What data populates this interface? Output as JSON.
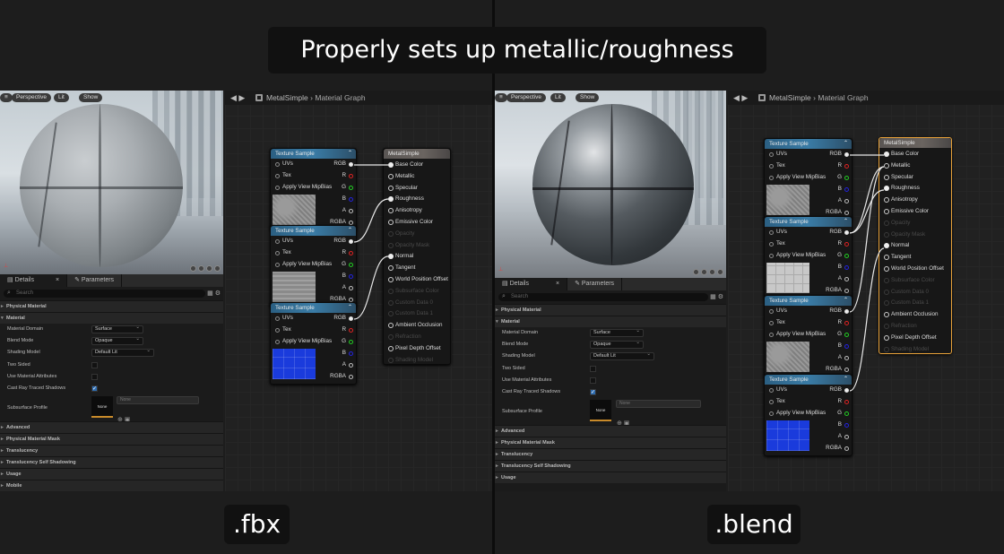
{
  "title": "Properly sets up metallic/roughness",
  "labels": {
    "left": ".fbx",
    "right": ".blend"
  },
  "viewport": {
    "perspective": "Perspective",
    "lit": "Lit",
    "show": "Show"
  },
  "details": {
    "tab_details": "Details",
    "tab_close": "×",
    "tab_parameters": "Parameters",
    "search_placeholder": "Search",
    "categories": {
      "physical_material": "Physical Material",
      "material": "Material",
      "advanced": "Advanced",
      "physical_material_mask": "Physical Material Mask",
      "translucency": "Translucency",
      "translucency_self_shadowing": "Translucency Self Shadowing",
      "usage": "Usage",
      "mobile": "Mobile"
    },
    "props": {
      "material_domain": {
        "label": "Material Domain",
        "value": "Surface"
      },
      "blend_mode": {
        "label": "Blend Mode",
        "value": "Opaque"
      },
      "shading_model": {
        "label": "Shading Model",
        "value": "Default Lit"
      },
      "two_sided": {
        "label": "Two Sided",
        "checked": false
      },
      "use_material_attributes": {
        "label": "Use Material Attributes",
        "checked": false
      },
      "cast_ray_traced_shadows": {
        "label": "Cast Ray Traced Shadows",
        "checked": true
      },
      "subsurface_profile": {
        "label": "Subsurface Profile",
        "thumb": "None",
        "value": "None"
      }
    }
  },
  "graph": {
    "breadcrumb_asset": "MetalSimple",
    "breadcrumb_sep": "›",
    "breadcrumb_page": "Material Graph",
    "texture_sample": {
      "title": "Texture Sample",
      "inputs": [
        "UVs",
        "Tex",
        "Apply View MipBias"
      ],
      "outputs": [
        "RGB",
        "R",
        "G",
        "B",
        "A",
        "RGBA"
      ]
    },
    "material": {
      "title": "MetalSimple",
      "inputs": [
        "Base Color",
        "Metallic",
        "Specular",
        "Roughness",
        "Anisotropy",
        "Emissive Color",
        "Opacity",
        "Opacity Mask",
        "Normal",
        "Tangent",
        "World Position Offset",
        "Subsurface Color",
        "Custom Data 0",
        "Custom Data 1",
        "Ambient Occlusion",
        "Refraction",
        "Pixel Depth Offset",
        "Shading Model"
      ],
      "dimmed": [
        "Opacity",
        "Opacity Mask",
        "Subsurface Color",
        "Custom Data 0",
        "Custom Data 1",
        "Refraction",
        "Shading Model"
      ]
    }
  }
}
